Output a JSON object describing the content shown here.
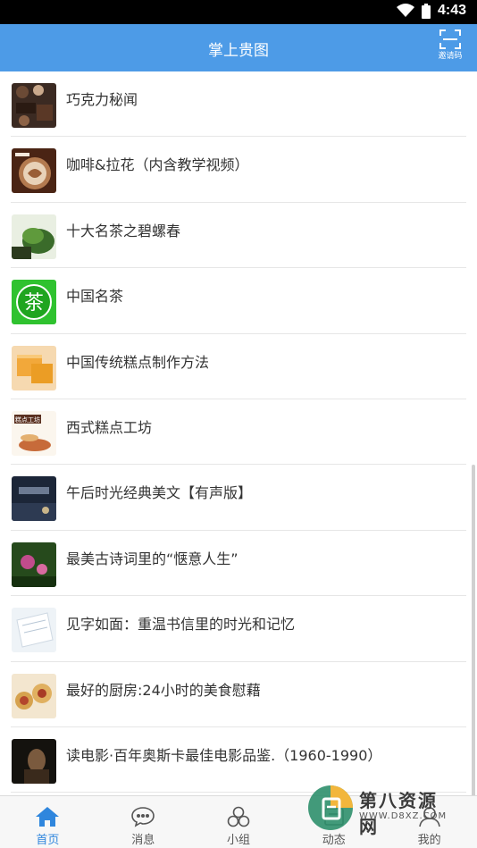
{
  "status": {
    "time": "4:43"
  },
  "app": {
    "title": "掌上贵图",
    "scan_label": "邀请码"
  },
  "list": [
    {
      "title": "巧克力秘闻",
      "thumb": "chocolate"
    },
    {
      "title": "咖啡&拉花（内含教学视频）",
      "thumb": "coffee"
    },
    {
      "title": "十大名茶之碧螺春",
      "thumb": "tea-leaves"
    },
    {
      "title": "中国名茶",
      "thumb": "tea-badge"
    },
    {
      "title": "中国传统糕点制作方法",
      "thumb": "cake"
    },
    {
      "title": "西式糕点工坊",
      "thumb": "pastry"
    },
    {
      "title": "午后时光经典美文【有声版】",
      "thumb": "night"
    },
    {
      "title": "最美古诗词里的“惬意人生”",
      "thumb": "flower"
    },
    {
      "title": "见字如面：重温书信里的时光和记忆",
      "thumb": "letters"
    },
    {
      "title": "最好的厨房:24小时的美食慰藉",
      "thumb": "food"
    },
    {
      "title": "读电影·百年奥斯卡最佳电影品鉴.（1960-1990）",
      "thumb": "movie"
    }
  ],
  "thumb_text": {
    "tea_badge_char": "茶",
    "pastry_sign": "糕点工坊"
  },
  "nav": [
    {
      "label": "首页",
      "icon": "home-icon"
    },
    {
      "label": "消息",
      "icon": "chat-icon"
    },
    {
      "label": "小组",
      "icon": "group-icon"
    },
    {
      "label": "动态",
      "icon": "activity-icon"
    },
    {
      "label": "我的",
      "icon": "user-icon"
    }
  ],
  "watermark": {
    "title": "第八资源网",
    "url": "WWW.D8XZ.COM"
  },
  "colors": {
    "appbar": "#4d9be7",
    "active_nav": "#2f86dd"
  }
}
